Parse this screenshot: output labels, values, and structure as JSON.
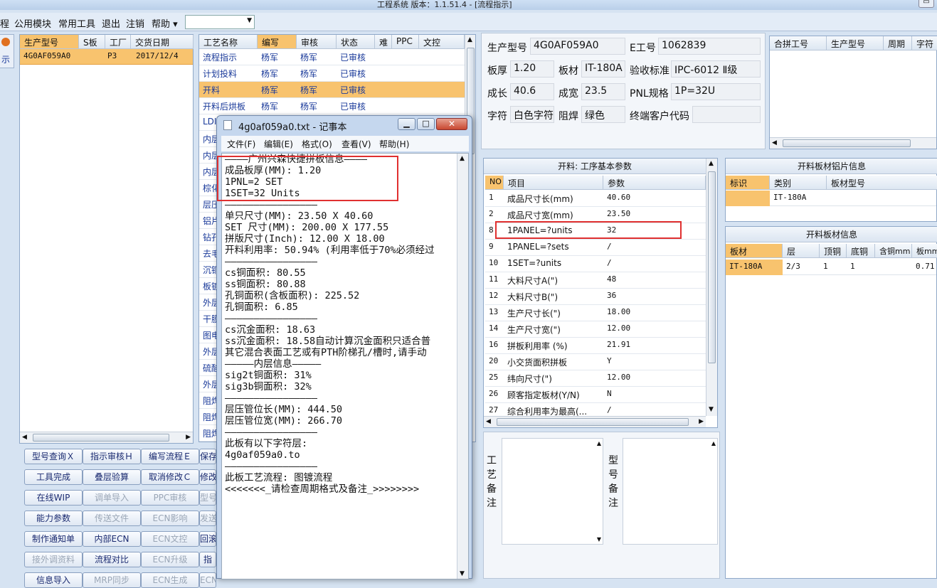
{
  "window": {
    "title": "工程系统   版本：1.1.51.4 - [流程指示]"
  },
  "menu": {
    "items": [
      "程",
      "公用模块",
      "常用工具",
      "退出",
      "注销",
      "帮助 ▾"
    ],
    "combo_value": ""
  },
  "side_tab": {
    "label": "示"
  },
  "orders": {
    "headers": [
      "生产型号",
      "S板",
      "工厂",
      "交货日期"
    ],
    "rows": [
      {
        "model": "4G0AF059A0",
        "s": "",
        "factory": "P3",
        "date": "2017/12/4"
      }
    ]
  },
  "process": {
    "headers": [
      "工艺名称",
      "编写",
      "审核",
      "状态",
      "难",
      "PPC",
      "文控"
    ],
    "rows": [
      {
        "name": "流程指示",
        "writer": "杨军",
        "reviewer": "杨军",
        "status": "已审核"
      },
      {
        "name": "计划投料",
        "writer": "杨军",
        "reviewer": "杨军",
        "status": "已审核"
      },
      {
        "name": "开料",
        "writer": "杨军",
        "reviewer": "杨军",
        "status": "已审核"
      },
      {
        "name": "开料后烘板",
        "writer": "杨军",
        "reviewer": "杨军",
        "status": "已审核"
      },
      {
        "name": "LDI",
        "writer": "",
        "reviewer": "",
        "status": ""
      },
      {
        "name": "内层",
        "writer": "",
        "reviewer": "",
        "status": ""
      },
      {
        "name": "内层",
        "writer": "",
        "reviewer": "",
        "status": ""
      },
      {
        "name": "内层",
        "writer": "",
        "reviewer": "",
        "status": ""
      },
      {
        "name": "棕化",
        "writer": "",
        "reviewer": "",
        "status": ""
      },
      {
        "name": "层压",
        "writer": "",
        "reviewer": "",
        "status": ""
      },
      {
        "name": "铝片",
        "writer": "",
        "reviewer": "",
        "status": ""
      },
      {
        "name": "钻孔",
        "writer": "",
        "reviewer": "",
        "status": ""
      },
      {
        "name": "去毛",
        "writer": "",
        "reviewer": "",
        "status": ""
      },
      {
        "name": "沉铜",
        "writer": "",
        "reviewer": "",
        "status": ""
      },
      {
        "name": "板镀",
        "writer": "",
        "reviewer": "",
        "status": ""
      },
      {
        "name": "外层",
        "writer": "",
        "reviewer": "",
        "status": ""
      },
      {
        "name": "干膜",
        "writer": "",
        "reviewer": "",
        "status": ""
      },
      {
        "name": "图电",
        "writer": "",
        "reviewer": "",
        "status": ""
      },
      {
        "name": "外层",
        "writer": "",
        "reviewer": "",
        "status": ""
      },
      {
        "name": "硫酸",
        "writer": "",
        "reviewer": "",
        "status": ""
      },
      {
        "name": "外层",
        "writer": "",
        "reviewer": "",
        "status": ""
      },
      {
        "name": "阻焊",
        "writer": "",
        "reviewer": "",
        "status": ""
      },
      {
        "name": "阻焊",
        "writer": "",
        "reviewer": "",
        "status": ""
      },
      {
        "name": "阻焊",
        "writer": "",
        "reviewer": "",
        "status": ""
      }
    ]
  },
  "buttons": [
    [
      "型号查询Ｘ",
      "指示审核Ｈ",
      "编写流程Ｅ",
      "保存"
    ],
    [
      "工具完成",
      "叠层验算",
      "取消修改Ｃ",
      "修改"
    ],
    [
      "在线WIP",
      "调单导入",
      "PPC审核",
      "型号"
    ],
    [
      "能力参数",
      "传送文件",
      "ECN影响",
      "发送"
    ],
    [
      "制作通知单",
      "内部ECN",
      "ECN文控",
      "回滚"
    ],
    [
      "接外调资料",
      "流程对比",
      "ECN升级",
      "指"
    ],
    [
      "信息导入",
      "MRP同步",
      "ECN生成",
      "ECN"
    ]
  ],
  "buttons_disabled": [
    [
      false,
      false,
      false,
      false
    ],
    [
      false,
      false,
      false,
      false
    ],
    [
      false,
      true,
      true,
      true
    ],
    [
      false,
      true,
      true,
      true
    ],
    [
      false,
      false,
      true,
      false
    ],
    [
      true,
      false,
      true,
      false
    ],
    [
      false,
      true,
      true,
      true
    ]
  ],
  "notepad": {
    "title": "4g0af059a0.txt - 记事本",
    "menu": [
      "文件(F)",
      "编辑(E)",
      "格式(O)",
      "查看(V)",
      "帮助(H)"
    ],
    "lines": [
      "————广州兴森快捷拼板信息————",
      "成品板厚(MM): 1.20",
      "1PNL=2 SET",
      "1SET=32 Units",
      "————————————————",
      "单只尺寸(MM): 23.50 X 40.60",
      "SET 尺寸(MM): 200.00 X 177.55",
      "拼版尺寸(Inch): 12.00 X 18.00",
      "开料利用率: 50.94% (利用率低于70%必须经过",
      "————————————————",
      "cs铜面积: 80.55",
      "ss铜面积: 80.88",
      "孔铜面积(含板面积): 225.52",
      "孔铜面积: 6.85",
      "————————————————",
      "cs沉金面积: 18.63",
      "ss沉金面积: 18.58自动计算沉金面积只适合普",
      "其它混合表面工艺或有PTH阶梯孔/槽时,请手动",
      "—————内层信息—————",
      "sig2t铜面积: 31%",
      "sig3b铜面积: 32%",
      "————————————————",
      "层压管位长(MM): 444.50",
      "层压管位宽(MM): 266.70",
      "————————————————",
      "此板有以下字符层:",
      "4g0af059a0.to",
      "————————————————",
      "此板工艺流程: 图镀流程",
      "<<<<<<<_请检查周期格式及备注_>>>>>>>>"
    ]
  },
  "info": {
    "model_label": "生产型号",
    "model": "4G0AF059A0",
    "eno_label": "E工号",
    "eno": "1062839",
    "thick_label": "板厚",
    "thick": "1.20",
    "mat_label": "板材",
    "mat": "IT-180A",
    "std_label": "验收标准",
    "std": "IPC-6012 Ⅱ级",
    "len_label": "成长",
    "len": "40.6",
    "wid_label": "成宽",
    "wid": "23.5",
    "pnl_label": "PNL规格",
    "pnl": "1P=32U",
    "char_label": "字符",
    "char": "白色字符",
    "mask_label": "阻焊",
    "mask": "绿色",
    "cust_label": "终端客户代码",
    "cust": ""
  },
  "merge": {
    "headers": [
      "合拼工号",
      "生产型号",
      "周期",
      "字符"
    ]
  },
  "params": {
    "title": "开料: 工序基本参数",
    "headers": [
      "NO",
      "项目",
      "参数"
    ],
    "rows": [
      {
        "no": "1",
        "item": "成品尺寸长(mm)",
        "val": "40.60"
      },
      {
        "no": "2",
        "item": "成品尺寸宽(mm)",
        "val": "23.50"
      },
      {
        "no": "8",
        "item": "1PANEL=?units",
        "val": "32"
      },
      {
        "no": "9",
        "item": "1PANEL=?sets",
        "val": "/"
      },
      {
        "no": "10",
        "item": "1SET=?units",
        "val": "/"
      },
      {
        "no": "11",
        "item": "大料尺寸A(\")",
        "val": "48"
      },
      {
        "no": "12",
        "item": "大料尺寸B(\")",
        "val": "36"
      },
      {
        "no": "13",
        "item": "生产尺寸长(\")",
        "val": "18.00"
      },
      {
        "no": "14",
        "item": "生产尺寸宽(\")",
        "val": "12.00"
      },
      {
        "no": "16",
        "item": "拼板利用率 (%)",
        "val": "21.91"
      },
      {
        "no": "20",
        "item": "小交货面积拼板",
        "val": "Y"
      },
      {
        "no": "25",
        "item": "纬向尺寸(\")",
        "val": "12.00"
      },
      {
        "no": "26",
        "item": "顾客指定板材(Y/N)",
        "val": "N"
      },
      {
        "no": "27",
        "item": "综合利用率为最高(...",
        "val": "/"
      }
    ]
  },
  "alu": {
    "title": "开料板材铝片信息",
    "headers": [
      "标识",
      "类别",
      "板材型号"
    ],
    "rows": [
      {
        "id": "",
        "type": "IT-180A",
        "model": ""
      }
    ]
  },
  "mat": {
    "title": "开料板材信息",
    "headers": [
      "板材",
      "层",
      "顶铜",
      "底铜",
      "含铜mm",
      "板mm"
    ],
    "rows": [
      {
        "m": "IT-180A",
        "layer": "2/3",
        "top": "1",
        "bot": "1",
        "cu": "",
        "thick": "0.71"
      }
    ]
  },
  "remarks": {
    "proc": "工艺备注",
    "model": "型号备注"
  },
  "colors": {
    "highlight": "#f8c36e",
    "red": "#e03030"
  }
}
